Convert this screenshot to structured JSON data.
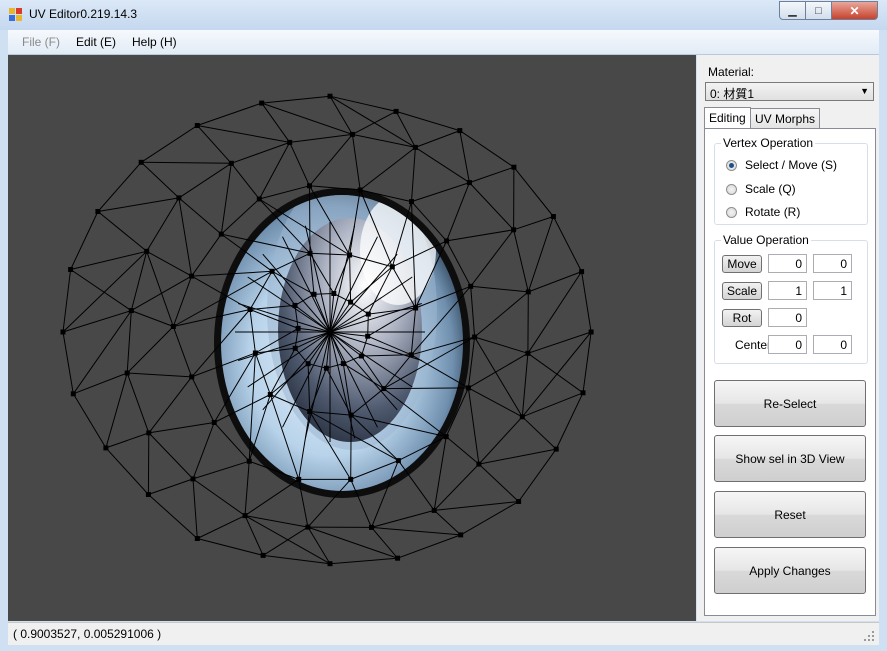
{
  "window": {
    "title": "UV Editor0.219.14.3",
    "min_glyph": "▁",
    "max_glyph": "□",
    "close_glyph": "✕"
  },
  "menu": [
    {
      "label": "File (F)",
      "enabled": false
    },
    {
      "label": "Edit (E)",
      "enabled": true
    },
    {
      "label": "Help (H)",
      "enabled": true
    }
  ],
  "material": {
    "label": "Material:",
    "selected": "0: 材質1"
  },
  "tabs": [
    {
      "label": "Editing",
      "active": true
    },
    {
      "label": "UV Morphs",
      "active": false
    }
  ],
  "vertex_operation": {
    "title": "Vertex Operation",
    "options": [
      {
        "label": "Select / Move (S)",
        "checked": true
      },
      {
        "label": "Scale (Q)",
        "checked": false
      },
      {
        "label": "Rotate (R)",
        "checked": false
      }
    ]
  },
  "value_operation": {
    "title": "Value Operation",
    "move": {
      "label": "Move",
      "x": "0",
      "y": "0"
    },
    "scale": {
      "label": "Scale",
      "x": "1",
      "y": "1"
    },
    "rot": {
      "label": "Rot",
      "value": "0"
    },
    "center": {
      "label": "Center",
      "x": "0",
      "y": "0"
    }
  },
  "actions": {
    "reselect": "Re-Select",
    "show_sel": "Show sel in 3D View",
    "reset": "Reset",
    "apply": "Apply Changes"
  },
  "status": {
    "coords": "( 0.9003527, 0.005291006 )"
  },
  "colors": {
    "canvas_bg": "#484848",
    "mesh": "#000000",
    "iris": "#9fc4e2",
    "pupil": "#2a3646"
  }
}
